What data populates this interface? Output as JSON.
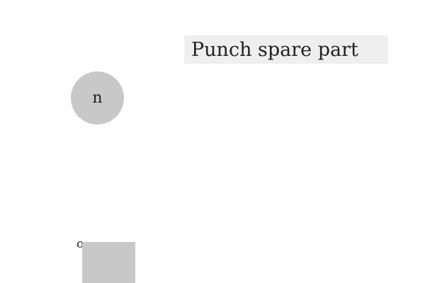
{
  "task": {
    "instruction": "Punch spare part"
  },
  "circle": {
    "label": "n",
    "color": "#c8c8c8"
  },
  "square": {
    "label": "o",
    "color": "#c8c8c8"
  },
  "banner": {
    "background": "#efefef"
  }
}
